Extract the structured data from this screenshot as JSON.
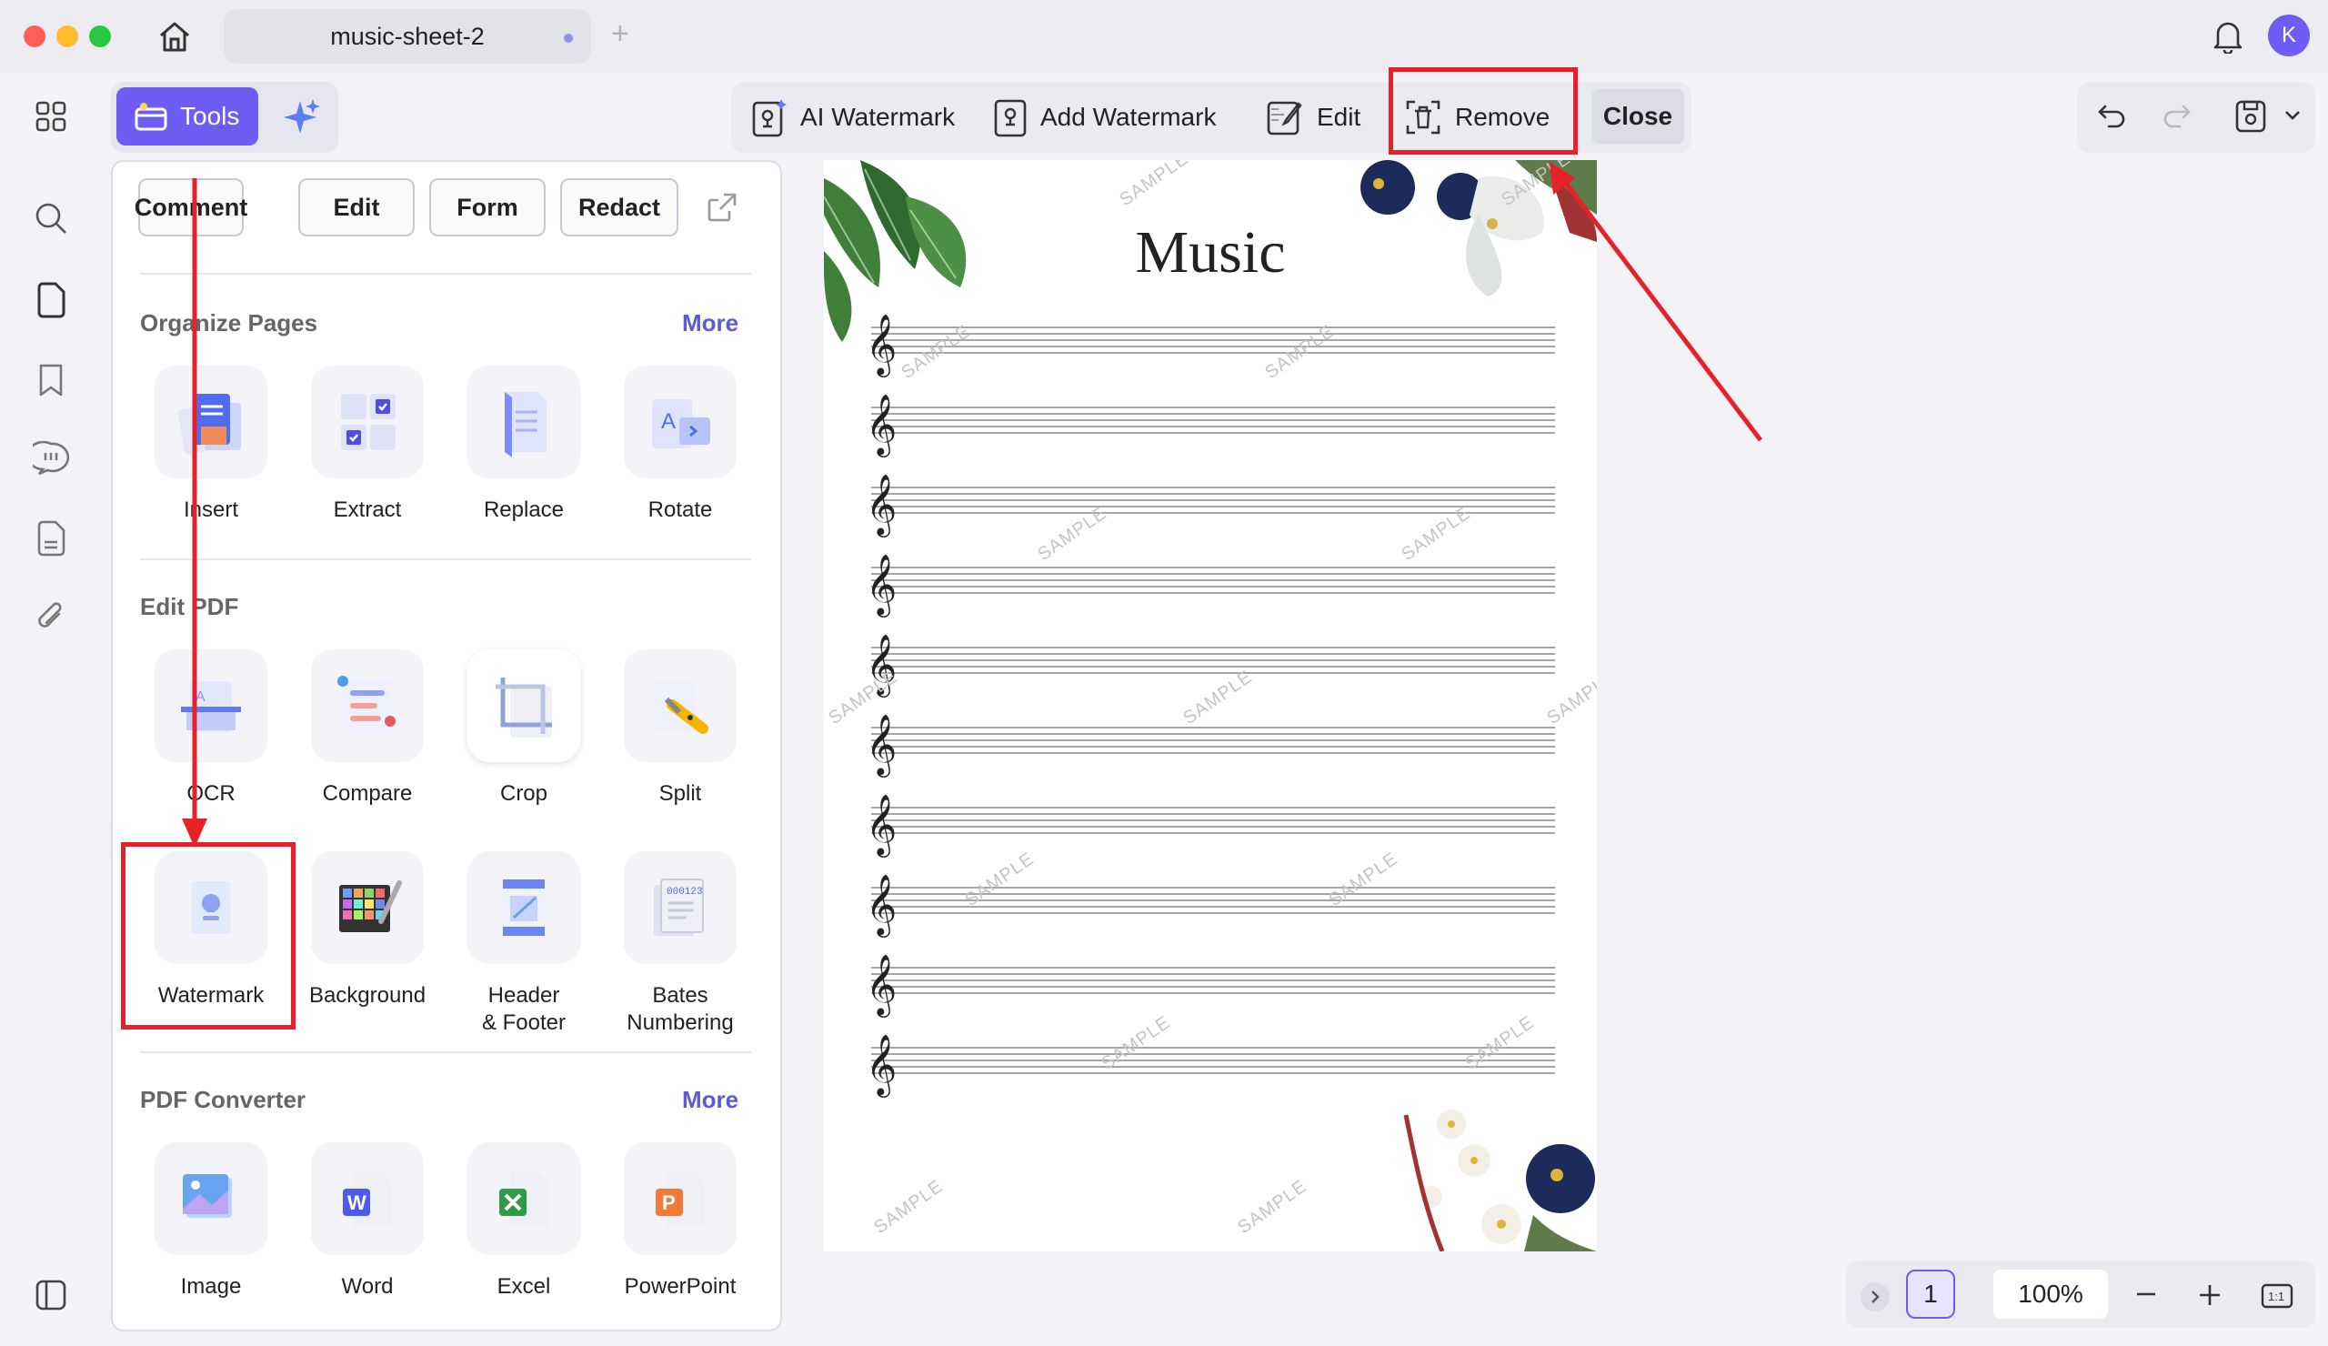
{
  "window": {
    "tab_title": "music-sheet-2",
    "avatar_letter": "K"
  },
  "tools": {
    "label": "Tools",
    "mode_buttons": [
      "Comment",
      "Edit",
      "Form",
      "Redact"
    ]
  },
  "sections": {
    "organize": {
      "title": "Organize Pages",
      "more": "More",
      "items": [
        "Insert",
        "Extract",
        "Replace",
        "Rotate"
      ]
    },
    "edit_pdf": {
      "title": "Edit PDF",
      "items": [
        "OCR",
        "Compare",
        "Crop",
        "Split",
        "Watermark",
        "Background",
        "Header\n& Footer",
        "Bates\nNumbering"
      ]
    },
    "converter": {
      "title": "PDF Converter",
      "more": "More",
      "items": [
        "Image",
        "Word",
        "Excel",
        "PowerPoint"
      ]
    }
  },
  "watermark_toolbar": {
    "ai_watermark": "AI Watermark",
    "add_watermark": "Add Watermark",
    "edit": "Edit",
    "remove": "Remove",
    "close": "Close"
  },
  "document": {
    "title": "Music",
    "watermark_text": "SAMPLE"
  },
  "footer": {
    "page_number": "1",
    "zoom": "100%"
  },
  "colors": {
    "accent": "#6e5cf5",
    "annotation": "#e8202a",
    "link": "#5b5bd6"
  }
}
